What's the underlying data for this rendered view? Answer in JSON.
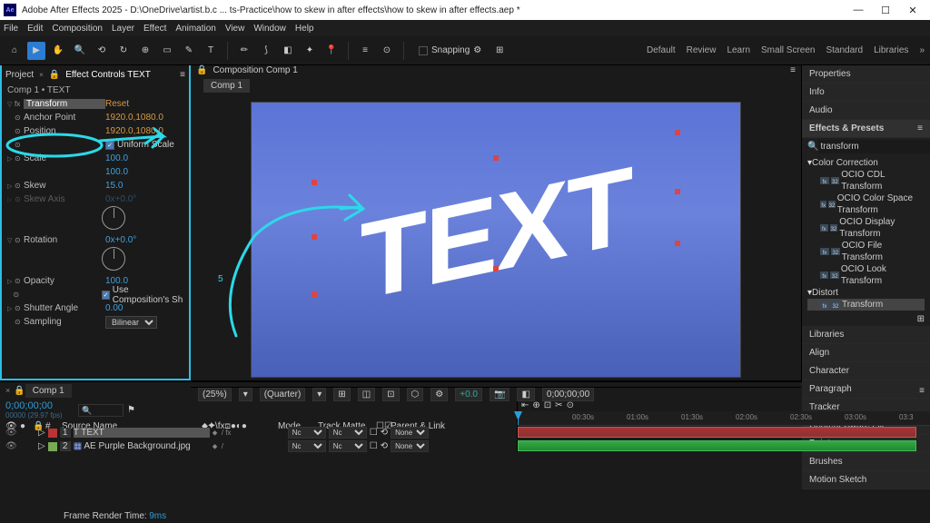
{
  "window": {
    "title": "Adobe After Effects 2025 - D:\\OneDrive\\artist.b.c ... ts-Practice\\how to skew in after effects\\how to skew in after effects.aep *",
    "logo": "Ae"
  },
  "menu": [
    "File",
    "Edit",
    "Composition",
    "Layer",
    "Effect",
    "Animation",
    "View",
    "Window",
    "Help"
  ],
  "workspaces": [
    "Default",
    "Review",
    "Learn",
    "Small Screen",
    "Standard",
    "Libraries"
  ],
  "snapping": "Snapping",
  "left": {
    "tab_project": "Project",
    "tab_ec": "Effect Controls TEXT",
    "header": "Comp 1 • TEXT",
    "fx_name": "Transform",
    "reset": "Reset",
    "props": {
      "anchor": {
        "label": "Anchor Point",
        "val": "1920.0,1080.0"
      },
      "position": {
        "label": "Position",
        "val": "1920.0,1080.0"
      },
      "uniform": {
        "label": "Uniform Scale"
      },
      "scale": {
        "label": "Scale",
        "val": "100.0"
      },
      "scale2": {
        "val": "100.0"
      },
      "skew": {
        "label": "Skew",
        "val": "15.0"
      },
      "skewaxis": {
        "label": "Skew Axis",
        "val": "0x+0.0°"
      },
      "rotation": {
        "label": "Rotation",
        "val": "0x+0.0°"
      },
      "opacity": {
        "label": "Opacity",
        "val": "100.0"
      },
      "usecomp": {
        "label": "Use Composition's Sh"
      },
      "shutter": {
        "label": "Shutter Angle",
        "val": "0.00"
      },
      "sampling": {
        "label": "Sampling",
        "val": "Bilinear"
      }
    }
  },
  "comp": {
    "tabhead": "Composition Comp 1",
    "tab": "Comp 1",
    "text": "TEXT",
    "zoom": "(25%)",
    "res": "(Quarter)",
    "exposure": "+0.0",
    "timecode": "0;00;00;00"
  },
  "right": {
    "panels": [
      "Properties",
      "Info",
      "Audio"
    ],
    "ep_head": "Effects & Presets",
    "search": "transform",
    "tree": {
      "cat1": "Color Correction",
      "items1": [
        "OCIO CDL Transform",
        "OCIO Color Space Transform",
        "OCIO Display Transform",
        "OCIO File Transform",
        "OCIO Look Transform"
      ],
      "cat2": "Distort",
      "items2": [
        "Transform"
      ]
    },
    "panels2": [
      "Libraries",
      "Align",
      "Character",
      "Paragraph",
      "Tracker",
      "Content-Aware Fill",
      "Paint",
      "Brushes",
      "Motion Sketch"
    ]
  },
  "timeline": {
    "tab": "Comp 1",
    "timecode": "0;00;00;00",
    "frames": "00000 (29.97 fps)",
    "search": "",
    "col_source": "Source Name",
    "col_mode": "Mode",
    "col_trk": "Track Matte",
    "col_parent": "Parent & Link",
    "ticks": [
      "00:30s",
      "01:00s",
      "01:30s",
      "02:00s",
      "02:30s",
      "03:00s",
      "03:3"
    ],
    "rows": [
      {
        "num": "1",
        "color": "#b33",
        "name": "T TEXT",
        "mode": "Nc",
        "parent": "None",
        "sel": true
      },
      {
        "num": "2",
        "color": "#7a5",
        "name": "AE Purple Background.jpg",
        "mode": "Nc",
        "parent": "None"
      }
    ],
    "footer": "Frame Render Time:",
    "footer_t": "9ms"
  },
  "annotation_num": "5"
}
